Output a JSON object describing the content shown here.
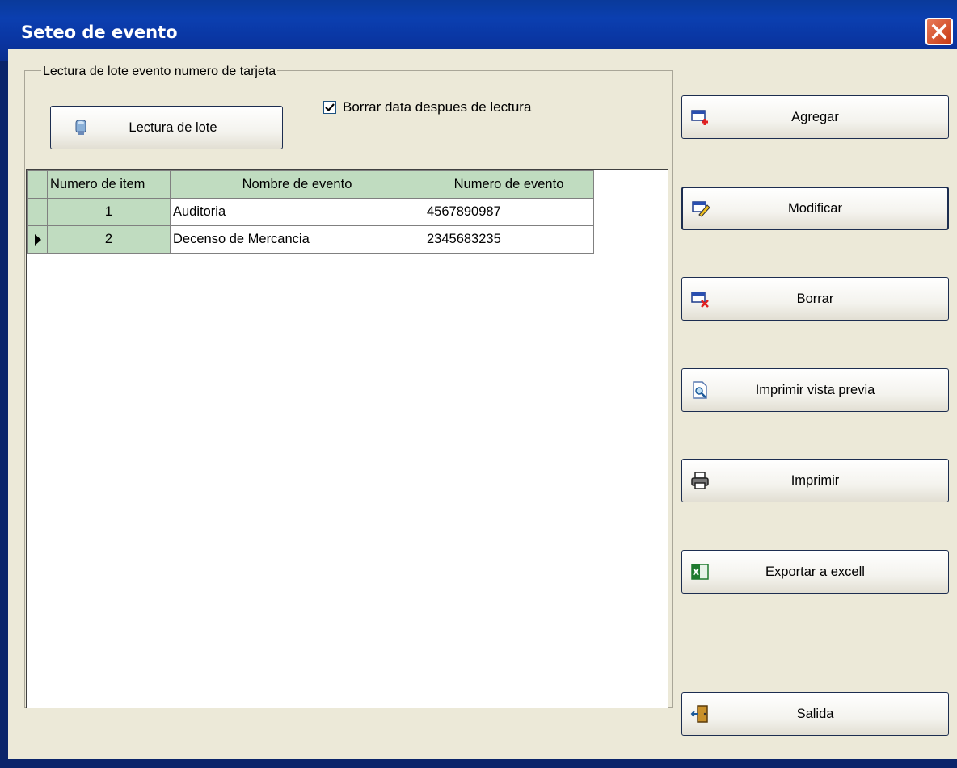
{
  "window": {
    "title": "Seteo de evento"
  },
  "group": {
    "legend": "Lectura de lote evento numero de tarjeta",
    "read_button": "Lectura de lote",
    "checkbox_label": "Borrar data despues de lectura",
    "checkbox_checked": true
  },
  "grid": {
    "columns": [
      "Numero de item",
      "Nombre de evento",
      "Numero de evento"
    ],
    "rows": [
      {
        "item": "1",
        "name": "Auditoria",
        "number": "4567890987"
      },
      {
        "item": "2",
        "name": "Decenso de Mercancia",
        "number": "2345683235"
      }
    ]
  },
  "actions": {
    "add": "Agregar",
    "modify": "Modificar",
    "delete": "Borrar",
    "preview": "Imprimir vista previa",
    "print": "Imprimir",
    "export": "Exportar a excell",
    "exit": "Salida"
  },
  "icons": {
    "close": "close-icon",
    "read": "card-reader-icon",
    "add": "add-record-icon",
    "modify": "edit-record-icon",
    "delete": "delete-record-icon",
    "preview": "print-preview-icon",
    "print": "printer-icon",
    "export": "excel-icon",
    "exit": "exit-door-icon"
  },
  "colors": {
    "titlebar": "#0a3a9a",
    "client": "#ece9d8",
    "grid_header": "#c0dcc0",
    "close_button": "#d44a20"
  }
}
